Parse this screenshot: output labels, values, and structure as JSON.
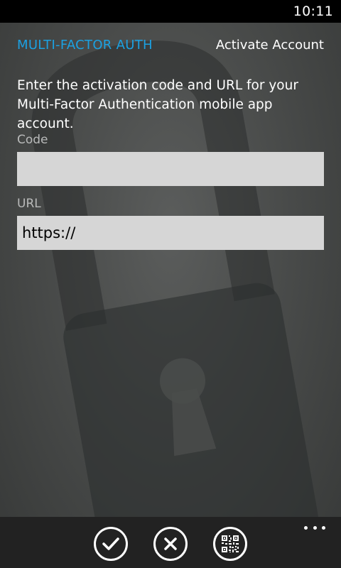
{
  "status_bar": {
    "time": "10:11"
  },
  "header": {
    "app_title": "MULTI-FACTOR AUTH",
    "page_title": "Activate Account"
  },
  "instructions": "Enter the activation code and URL for your Multi-Factor Authentication mobile app account.",
  "form": {
    "code": {
      "label": "Code",
      "value": ""
    },
    "url": {
      "label": "URL",
      "value": "https://"
    }
  },
  "app_bar": {
    "buttons": [
      {
        "name": "accept",
        "icon": "check-icon"
      },
      {
        "name": "cancel",
        "icon": "close-icon"
      },
      {
        "name": "scan",
        "icon": "qr-code-icon"
      }
    ],
    "more_icon": "ellipsis-icon"
  },
  "colors": {
    "accent": "#1ba1e2",
    "background": "#4a4c4b",
    "field": "#d6d6d6",
    "app_bar": "#222222"
  }
}
